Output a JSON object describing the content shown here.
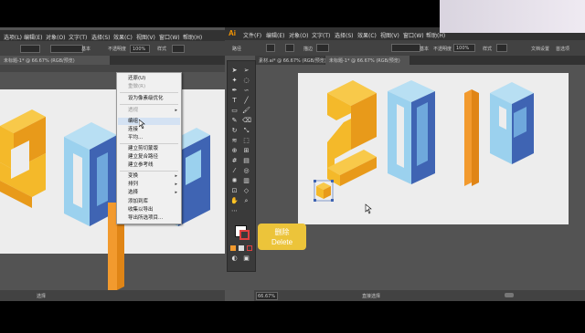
{
  "left_window": {
    "menu": [
      "选项(L)",
      "编辑(E)",
      "对象(O)",
      "文字(T)",
      "选择(S)",
      "效果(C)",
      "视图(V)",
      "窗口(W)",
      "帮助(H)"
    ],
    "control_bar": {
      "stroke_label": "基本",
      "opacity_label": "不透明度",
      "opacity_value": "100%",
      "style_label": "样式"
    },
    "tab_title": "未标题-1* @ 66.67% (RGB/预览)",
    "status_text": "选择"
  },
  "context_menu": {
    "items": [
      {
        "label": "还原(U)",
        "disabled": false
      },
      {
        "label": "重做(R)",
        "disabled": true
      },
      {
        "label": "设为像素级优化",
        "disabled": false
      },
      {
        "label": "透视",
        "disabled": true,
        "submenu": true
      },
      {
        "label": "编组",
        "disabled": false,
        "highlighted": true
      },
      {
        "label": "连接",
        "disabled": false
      },
      {
        "label": "平均...",
        "disabled": false
      },
      {
        "label": "建立剪切蒙版",
        "disabled": false
      },
      {
        "label": "建立复合路径",
        "disabled": false
      },
      {
        "label": "建立参考线",
        "disabled": false
      },
      {
        "label": "变换",
        "disabled": false,
        "submenu": true
      },
      {
        "label": "排列",
        "disabled": false,
        "submenu": true
      },
      {
        "label": "选择",
        "disabled": false,
        "submenu": true
      },
      {
        "label": "添加到库",
        "disabled": false
      },
      {
        "label": "收集以导出",
        "disabled": false
      },
      {
        "label": "导出所选项目...",
        "disabled": false
      }
    ]
  },
  "right_window": {
    "app_logo": "Ai",
    "menu": [
      "文件(F)",
      "编辑(E)",
      "对象(O)",
      "文字(T)",
      "选择(S)",
      "效果(C)",
      "视图(V)",
      "窗口(W)",
      "帮助(H)"
    ],
    "control_bar": {
      "path_label": "路径",
      "stroke_label": "描边",
      "basic_label": "基本",
      "opacity_label": "不透明度",
      "opacity_value": "100%",
      "style_label": "样式",
      "doc_settings": "文档设置",
      "prefs": "首选项"
    },
    "tab_secondary": "素材.ai* @ 66.67% (RGB/预览)",
    "tab_title": "未标题-1* @ 66.67% (RGB/预览)",
    "zoom_value": "66.67%",
    "status_text": "直接选择"
  },
  "artwork": {
    "text": "2019",
    "colors": {
      "yellow": "#f4b92a",
      "yellow_dark": "#e89a1a",
      "orange": "#f29a2e",
      "light_blue": "#9bd1ee",
      "mid_blue": "#6fa8dc",
      "dark_blue": "#3f64b3"
    }
  },
  "tooltip": {
    "title_cn": "删除",
    "title_en": "Delete"
  }
}
